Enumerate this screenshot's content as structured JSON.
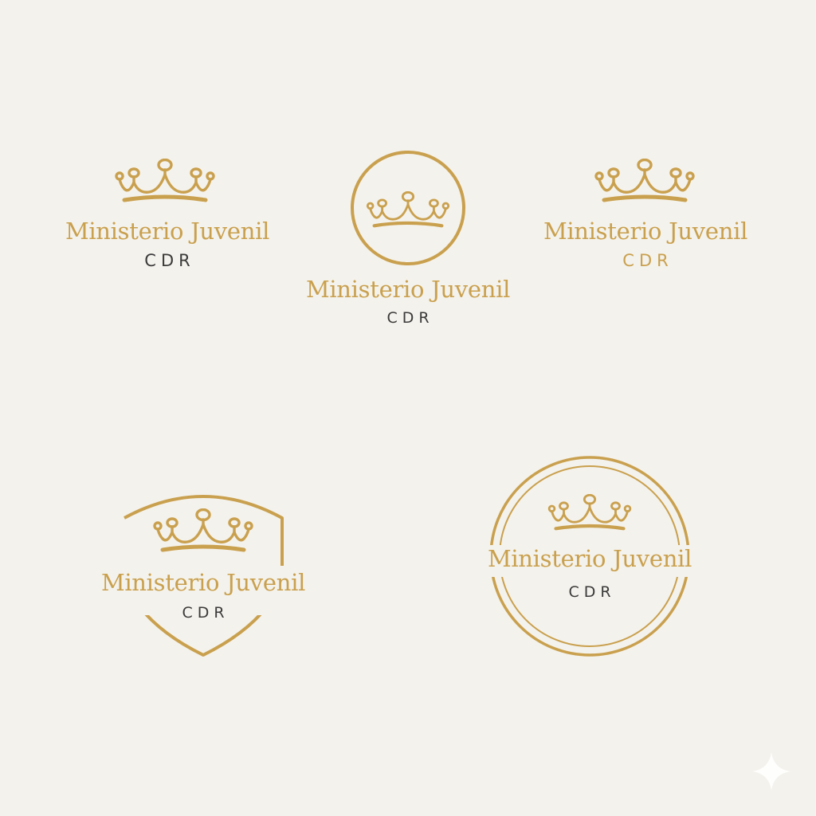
{
  "colors": {
    "background": "#f4f2ec",
    "gold": "#c9a04e",
    "dark_text": "#3a3a3a"
  },
  "logos": [
    {
      "variant": "plain-crown",
      "title": "Ministerio Juvenil",
      "subtitle": "CDR",
      "subtitle_color": "dark"
    },
    {
      "variant": "circle-emblem",
      "title": "Ministerio Juvenil",
      "subtitle": "CDR",
      "subtitle_color": "dark"
    },
    {
      "variant": "plain-crown",
      "title": "Ministerio Juvenil",
      "subtitle": "CDR",
      "subtitle_color": "gold"
    },
    {
      "variant": "shield-badge",
      "title": "Ministerio Juvenil",
      "subtitle": "CDR",
      "subtitle_color": "dark"
    },
    {
      "variant": "double-ring-seal",
      "title": "Ministerio Juvenil",
      "subtitle": "CDR",
      "subtitle_color": "dark"
    }
  ],
  "icons": {
    "crown": "crown-icon",
    "sparkle": "sparkle-icon"
  }
}
